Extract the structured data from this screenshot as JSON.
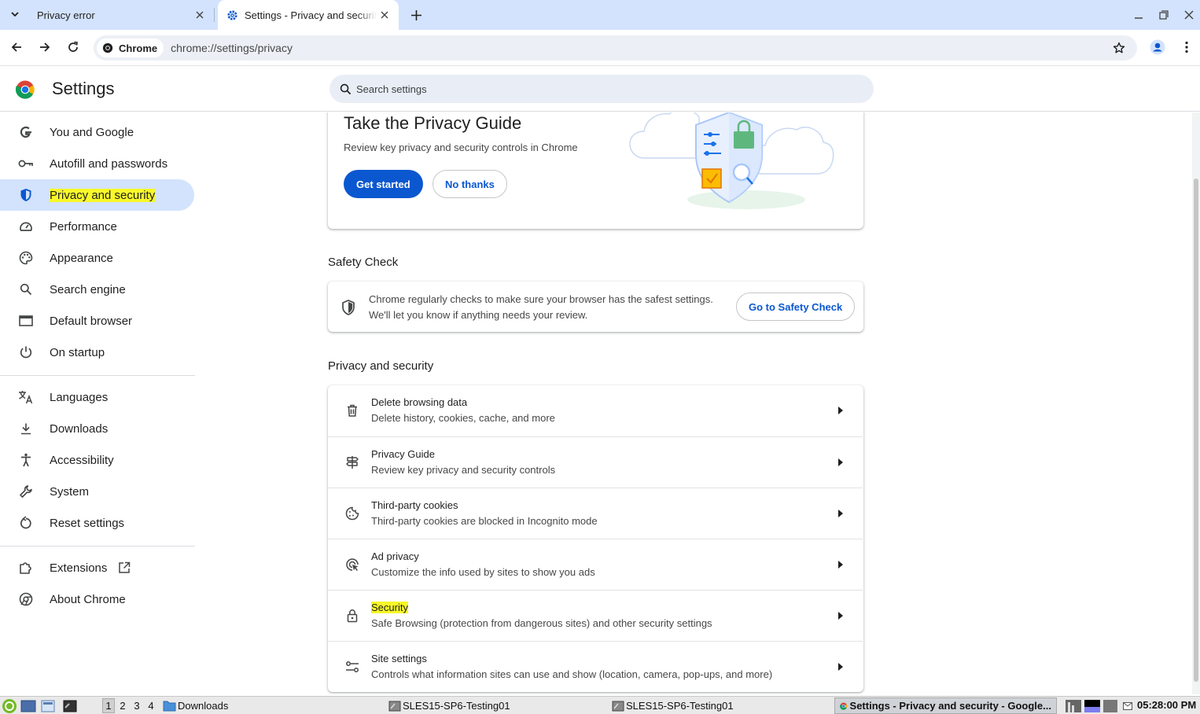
{
  "browser": {
    "tabs": [
      {
        "title": "Privacy error",
        "active": false
      },
      {
        "title": "Settings - Privacy and securit",
        "active": true
      }
    ],
    "site_chip": "Chrome",
    "url": "chrome://settings/privacy"
  },
  "settings": {
    "title": "Settings",
    "search_placeholder": "Search settings",
    "sidebar": [
      {
        "label": "You and Google",
        "icon": "google-icon"
      },
      {
        "label": "Autofill and passwords",
        "icon": "key-icon"
      },
      {
        "label": "Privacy and security",
        "icon": "shield-icon",
        "selected": true
      },
      {
        "label": "Performance",
        "icon": "speedometer-icon"
      },
      {
        "label": "Appearance",
        "icon": "palette-icon"
      },
      {
        "label": "Search engine",
        "icon": "search-icon"
      },
      {
        "label": "Default browser",
        "icon": "browser-window-icon"
      },
      {
        "label": "On startup",
        "icon": "power-icon"
      },
      {
        "label": "Languages",
        "icon": "translate-icon"
      },
      {
        "label": "Downloads",
        "icon": "download-icon"
      },
      {
        "label": "Accessibility",
        "icon": "accessibility-icon"
      },
      {
        "label": "System",
        "icon": "wrench-icon"
      },
      {
        "label": "Reset settings",
        "icon": "reset-icon"
      },
      {
        "label": "Extensions",
        "icon": "puzzle-icon"
      },
      {
        "label": "About Chrome",
        "icon": "chrome-icon"
      }
    ],
    "privacy_guide_promo": {
      "title": "Take the Privacy Guide",
      "description": "Review key privacy and security controls in Chrome",
      "primary_button": "Get started",
      "secondary_button": "No thanks"
    },
    "safety_check": {
      "section_title": "Safety Check",
      "line1": "Chrome regularly checks to make sure your browser has the safest settings.",
      "line2": "We'll let you know if anything needs your review.",
      "button": "Go to Safety Check"
    },
    "privacy_section": {
      "section_title": "Privacy and security",
      "rows": [
        {
          "title": "Delete browsing data",
          "subtitle": "Delete history, cookies, cache, and more",
          "icon": "trash-icon"
        },
        {
          "title": "Privacy Guide",
          "subtitle": "Review key privacy and security controls",
          "icon": "signpost-icon"
        },
        {
          "title": "Third-party cookies",
          "subtitle": "Third-party cookies are blocked in Incognito mode",
          "icon": "cookie-icon"
        },
        {
          "title": "Ad privacy",
          "subtitle": "Customize the info used by sites to show you ads",
          "icon": "ad-privacy-icon"
        },
        {
          "title": "Security",
          "subtitle": "Safe Browsing (protection from dangerous sites) and other security settings",
          "icon": "lock-icon"
        },
        {
          "title": "Site settings",
          "subtitle": "Controls what information sites can use and show (location, camera, pop-ups, and more)",
          "icon": "sliders-icon"
        }
      ]
    }
  },
  "taskbar": {
    "workspaces": [
      "1",
      "2",
      "3",
      "4"
    ],
    "downloads_label": "Downloads",
    "tasks": [
      "SLES15-SP6-Testing01",
      "SLES15-SP6-Testing01",
      "Settings - Privacy and security - Google..."
    ],
    "clock": "05:28:00 PM"
  },
  "colors": {
    "accent": "#0b57d0",
    "selected_nav_bg": "#d3e3fd",
    "highlight": "#f7f72a",
    "tabstrip_bg": "#d3e3fd"
  }
}
